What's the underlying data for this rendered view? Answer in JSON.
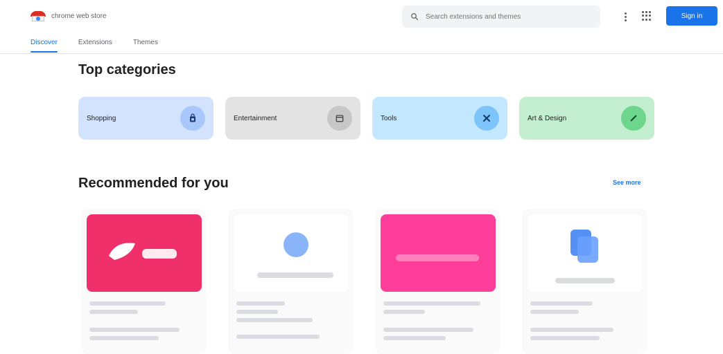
{
  "header": {
    "logo_text": "chrome web store",
    "tabs": [
      {
        "label": "Discover",
        "active": true
      },
      {
        "label": "Extensions",
        "active": false
      },
      {
        "label": "Themes",
        "active": false
      }
    ],
    "search_placeholder": "Search extensions and themes",
    "signin_label": "Sign in"
  },
  "top_categories": {
    "title": "Top categories",
    "items": [
      {
        "label": "Shopping",
        "bg": "#d3e3fd",
        "icon_bg": "#a8c7fa",
        "icon": "shopping-bag-icon"
      },
      {
        "label": "Entertainment",
        "bg": "#e3e3e3",
        "icon_bg": "#c7c7c7",
        "icon": "calendar-icon"
      },
      {
        "label": "Tools",
        "bg": "#c2e7ff",
        "icon_bg": "#7cc4fa",
        "icon": "tools-icon"
      },
      {
        "label": "Art & Design",
        "bg": "#c4eed0",
        "icon_bg": "#6dd58c",
        "icon": "pencil-icon"
      }
    ]
  },
  "recommended": {
    "title": "Recommended for you",
    "see_more": "See more",
    "items": [
      {
        "name": "",
        "thumb_color": "#f0306a",
        "accent": "#ffffff"
      },
      {
        "name": "",
        "thumb_color": "#ffffff",
        "accent": "#8ab4f8"
      },
      {
        "name": "",
        "thumb_color": "#ff3d9a",
        "accent": "#ffffff"
      },
      {
        "name": "",
        "thumb_color": "#ffffff",
        "accent": "#4285f4"
      }
    ]
  },
  "colors": {
    "accent": "#1a73e8",
    "text_primary": "#202124",
    "text_secondary": "#5f6368"
  }
}
